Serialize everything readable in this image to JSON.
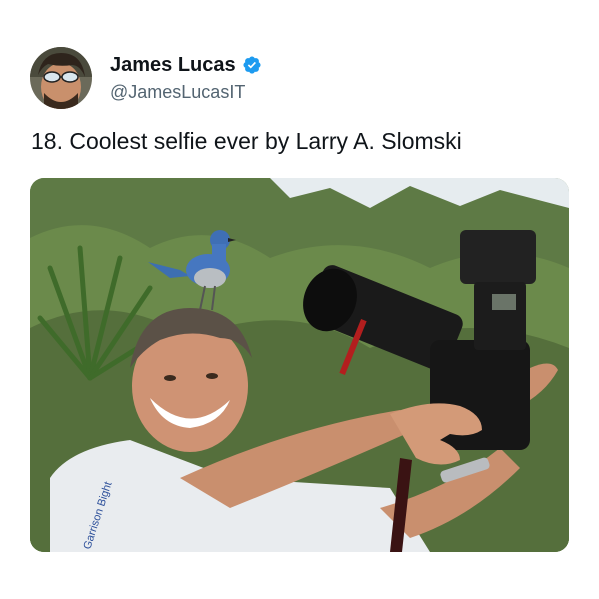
{
  "tweet": {
    "author": {
      "display_name": "James Lucas",
      "handle": "@JamesLucasIT",
      "verified": true,
      "avatar_icon": "avatar-photo",
      "verified_icon": "verified-badge-icon"
    },
    "text": "18. Coolest selfie ever by Larry A. Slomski",
    "media": {
      "kind": "photo",
      "shirt_print": "Garrison Bight"
    }
  },
  "colors": {
    "name": "#0f1419",
    "handle": "#536471",
    "verified": "#1d9bf0"
  }
}
